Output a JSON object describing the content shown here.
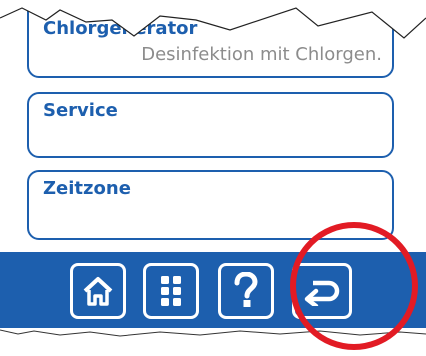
{
  "menu": {
    "items": [
      {
        "title": "Chlorgenerator",
        "subtitle": "Desinfektion mit Chlorgen."
      },
      {
        "title": "Service"
      },
      {
        "title": "Zeitzone"
      }
    ]
  },
  "nav": {
    "buttons": [
      {
        "icon": "home-icon"
      },
      {
        "icon": "grid-menu-icon"
      },
      {
        "icon": "help-icon"
      },
      {
        "icon": "back-return-icon"
      }
    ]
  },
  "colors": {
    "accent": "#1d5fae",
    "subtitle": "#8c8c8c",
    "highlight": "#e21b24",
    "background": "#ffffff"
  }
}
